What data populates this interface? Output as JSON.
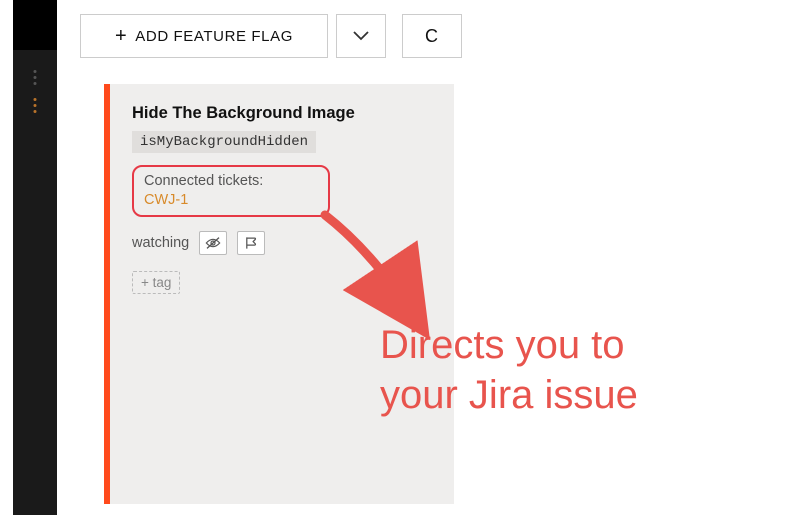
{
  "toolbar": {
    "add_label": "ADD FEATURE FLAG",
    "extra_letter": "C"
  },
  "card": {
    "title": "Hide The Background Image",
    "flag_key": "isMyBackgroundHidden",
    "connected_label": "Connected tickets:",
    "tickets": [
      {
        "id": "CWJ-1"
      }
    ],
    "watch_label": "watching",
    "add_tag_label": "+ tag"
  },
  "annotation": {
    "text_line1": "Directs you to",
    "text_line2": "your Jira issue"
  },
  "icons": {
    "plus": "plus-icon",
    "chevron_down": "chevron-down-icon",
    "eye_off": "eye-off-icon",
    "flag": "flag-icon"
  },
  "colors": {
    "accent": "#ff4a1c",
    "highlight_border": "#e63946",
    "annotation": "#e8544d",
    "ticket_link": "#d88a2a"
  }
}
